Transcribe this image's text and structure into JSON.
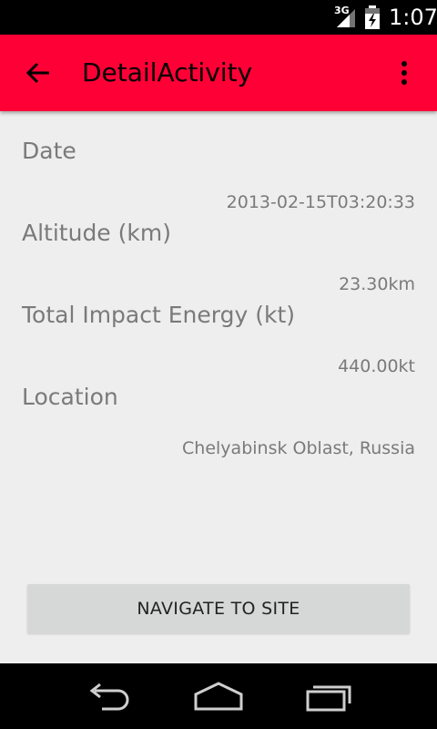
{
  "status_bar": {
    "network": "3G",
    "time": "1:07",
    "icons": [
      "signal-icon",
      "battery-icon"
    ]
  },
  "app_bar": {
    "title": "DetailActivity",
    "color": "#ff0036",
    "icons": [
      "back-arrow-icon",
      "overflow-menu-icon"
    ]
  },
  "details": {
    "date_label": "Date",
    "date_value": "2013-02-15T03:20:33",
    "altitude_label": "Altitude (km)",
    "altitude_value": "23.30km",
    "energy_label": "Total Impact Energy (kt)",
    "energy_value": "440.00kt",
    "location_label": "Location",
    "location_value": "Chelyabinsk Oblast, Russia"
  },
  "action": {
    "navigate_label": "NAVIGATE TO SITE"
  },
  "nav_bar": {
    "icons": [
      "back-icon",
      "home-icon",
      "recents-icon"
    ]
  }
}
